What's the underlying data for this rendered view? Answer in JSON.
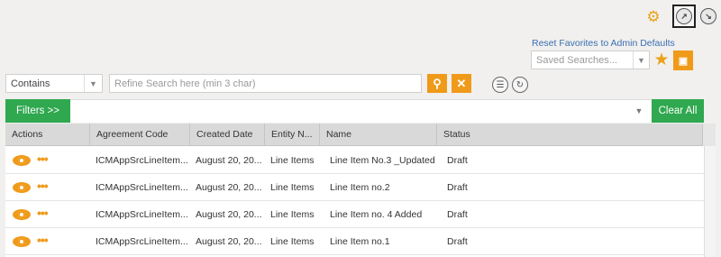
{
  "toolbar": {
    "gear_icon": "gear-icon",
    "export_icon": "export-icon",
    "import_icon": "import-icon",
    "reset_link": "Reset Favorites to Admin Defaults"
  },
  "saved_searches": {
    "placeholder": "Saved Searches...",
    "favorite_icon": "star-icon",
    "save_icon": "save-icon",
    "accent": "#f09a1a"
  },
  "search": {
    "operator": "Contains",
    "placeholder": "Refine Search here (min 3 char)",
    "value": ""
  },
  "filters": {
    "label": "Filters >>",
    "clear_label": "Clear All",
    "accent": "#2fa84f"
  },
  "table": {
    "columns": [
      "Actions",
      "Agreement Code",
      "Created Date",
      "Entity N...",
      "Name",
      "Status"
    ],
    "rows": [
      {
        "agreement_code": "ICMAppSrcLineItem...",
        "created_date": "August 20, 20...",
        "entity": "Line Items",
        "name": "Line Item No.3 _Updated",
        "status": "Draft"
      },
      {
        "agreement_code": "ICMAppSrcLineItem...",
        "created_date": "August 20, 20...",
        "entity": "Line Items",
        "name": "Line Item no.2",
        "status": "Draft"
      },
      {
        "agreement_code": "ICMAppSrcLineItem...",
        "created_date": "August 20, 20...",
        "entity": "Line Items",
        "name": "Line Item no. 4 Added",
        "status": "Draft"
      },
      {
        "agreement_code": "ICMAppSrcLineItem...",
        "created_date": "August 20, 20...",
        "entity": "Line Items",
        "name": "Line Item no.1",
        "status": "Draft"
      }
    ]
  }
}
